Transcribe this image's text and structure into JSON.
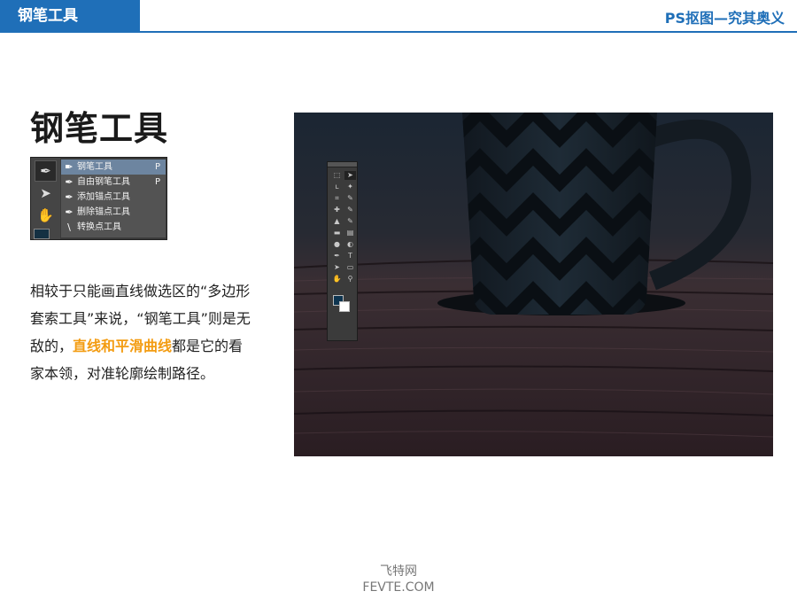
{
  "header": {
    "tab_label": "钢笔工具",
    "right_title": "PS抠图—究其奥义",
    "accent_color": "#1f6fb8"
  },
  "page": {
    "title": "钢笔工具"
  },
  "pen_menu": {
    "tools": [
      {
        "icon": "pen-tool-icon",
        "glyph": "✒"
      },
      {
        "icon": "arrow-select-icon",
        "glyph": "➤"
      },
      {
        "icon": "hand-tool-icon",
        "glyph": "✋"
      }
    ],
    "items": [
      {
        "icon": "pen-icon",
        "glyph": "✒",
        "label": "钢笔工具",
        "shortcut": "P",
        "selected": true
      },
      {
        "icon": "freeform-pen-icon",
        "glyph": "✒",
        "label": "自由钢笔工具",
        "shortcut": "P",
        "selected": false
      },
      {
        "icon": "add-anchor-icon",
        "glyph": "✒",
        "label": "添加锚点工具",
        "shortcut": "",
        "selected": false
      },
      {
        "icon": "delete-anchor-icon",
        "glyph": "✒",
        "label": "删除锚点工具",
        "shortcut": "",
        "selected": false
      },
      {
        "icon": "convert-point-icon",
        "glyph": "\\",
        "label": "转换点工具",
        "shortcut": "",
        "selected": false
      }
    ]
  },
  "description": {
    "text_before": "相较于只能画直线做选区的“多边形套索工具”来说，“钢笔工具”则是无敌的，",
    "highlight": "直线和平滑曲线",
    "text_after": "都是它的看家本领，对准轮廓绘制路径。",
    "highlight_color": "#f39c12"
  },
  "photo": {
    "toolbar_icons": [
      "marquee-icon",
      "move-icon",
      "lasso-icon",
      "magic-wand-icon",
      "crop-icon",
      "eyedropper-icon",
      "healing-icon",
      "brush-icon",
      "stamp-icon",
      "history-brush-icon",
      "eraser-icon",
      "gradient-icon",
      "blur-icon",
      "dodge-icon",
      "pen-icon",
      "type-icon",
      "path-select-icon",
      "shape-icon",
      "hand-icon",
      "zoom-icon"
    ],
    "foreground_color": "#0e3550",
    "background_color": "#ffffff"
  },
  "watermark": {
    "line1": "飞特网",
    "line2": "FEVTE.COM"
  }
}
